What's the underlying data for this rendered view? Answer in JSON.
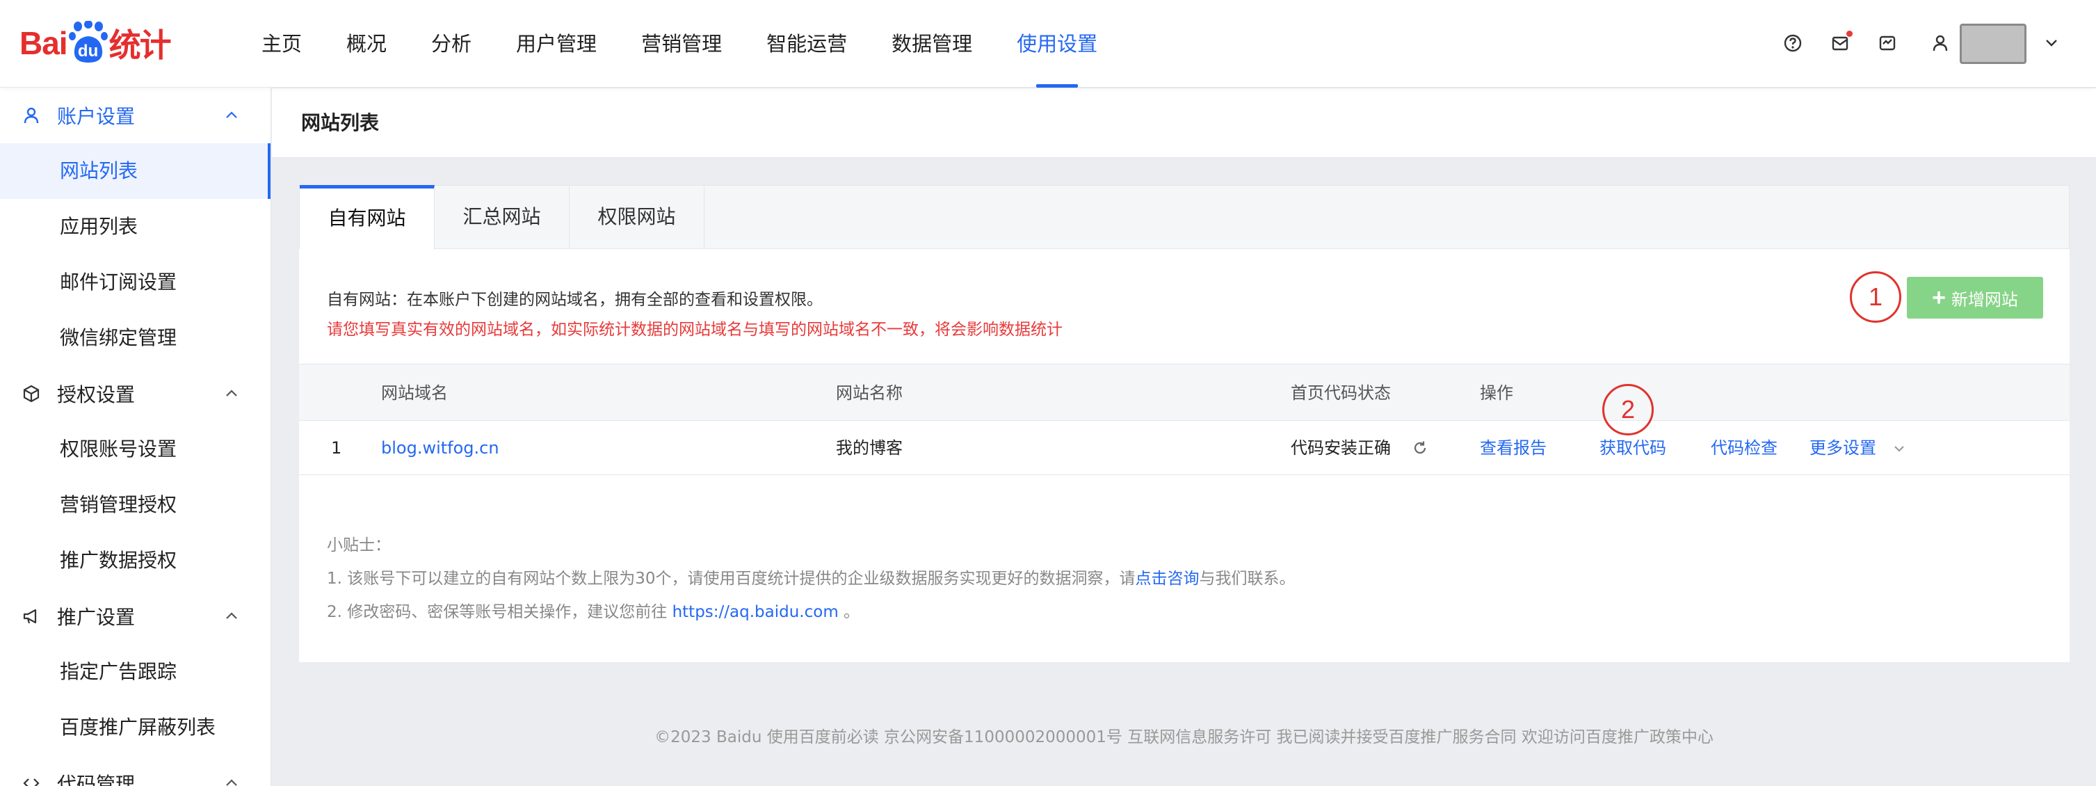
{
  "logo": {
    "part1": "Bai",
    "part2": "du",
    "part3": "统计"
  },
  "nav": [
    "主页",
    "概况",
    "分析",
    "用户管理",
    "营销管理",
    "智能运营",
    "数据管理",
    "使用设置"
  ],
  "nav_active": "使用设置",
  "header_icons": [
    "help-icon",
    "mail-icon",
    "message-icon",
    "user-icon",
    "chevron-down-icon"
  ],
  "sidebar": {
    "account_group": "账户设置",
    "account_items": [
      "网站列表",
      "应用列表",
      "邮件订阅设置",
      "微信绑定管理"
    ],
    "auth_group": "授权设置",
    "auth_items": [
      "权限账号设置",
      "营销管理授权",
      "推广数据授权"
    ],
    "promo_group": "推广设置",
    "promo_items": [
      "指定广告跟踪",
      "百度推广屏蔽列表"
    ],
    "code_group": "代码管理"
  },
  "page_title": "网站列表",
  "tabs": [
    "自有网站",
    "汇总网站",
    "权限网站"
  ],
  "description": "自有网站：在本账户下创建的网站域名，拥有全部的查看和设置权限。",
  "warning": "请您填写真实有效的网站域名，如实际统计数据的网站域名与填写的网站域名不一致，将会影响数据统计",
  "add_button": {
    "plus": "+",
    "label": "新增网站"
  },
  "annotations": [
    "1",
    "2"
  ],
  "table": {
    "headers": [
      "网站域名",
      "网站名称",
      "首页代码状态",
      "操作"
    ],
    "rows": [
      {
        "index": "1",
        "domain": "blog.witfog.cn",
        "name": "我的博客",
        "status": "代码安装正确",
        "actions": [
          "查看报告",
          "获取代码",
          "代码检查",
          "更多设置"
        ]
      }
    ]
  },
  "tips": {
    "title": "小贴士：",
    "line1_pre": "1. 该账号下可以建立的自有网站个数上限为30个，请使用百度统计提供的企业级数据服务实现更好的数据洞察，请",
    "line1_link": "点击咨询",
    "line1_post": "与我们联系。",
    "line2_pre": "2. 修改密码、密保等账号相关操作，建议您前往 ",
    "line2_link": "https://aq.baidu.com",
    "line2_post": " 。"
  },
  "footer": "©2023 Baidu 使用百度前必读 京公网安备11000002000001号 互联网信息服务许可 我已阅读并接受百度推广服务合同 欢迎访问百度推广政策中心",
  "colors": {
    "brand_red": "#e52e2e",
    "accent_blue": "#2468f2",
    "add_green": "#86d487",
    "warning_red": "#e83a3a"
  }
}
